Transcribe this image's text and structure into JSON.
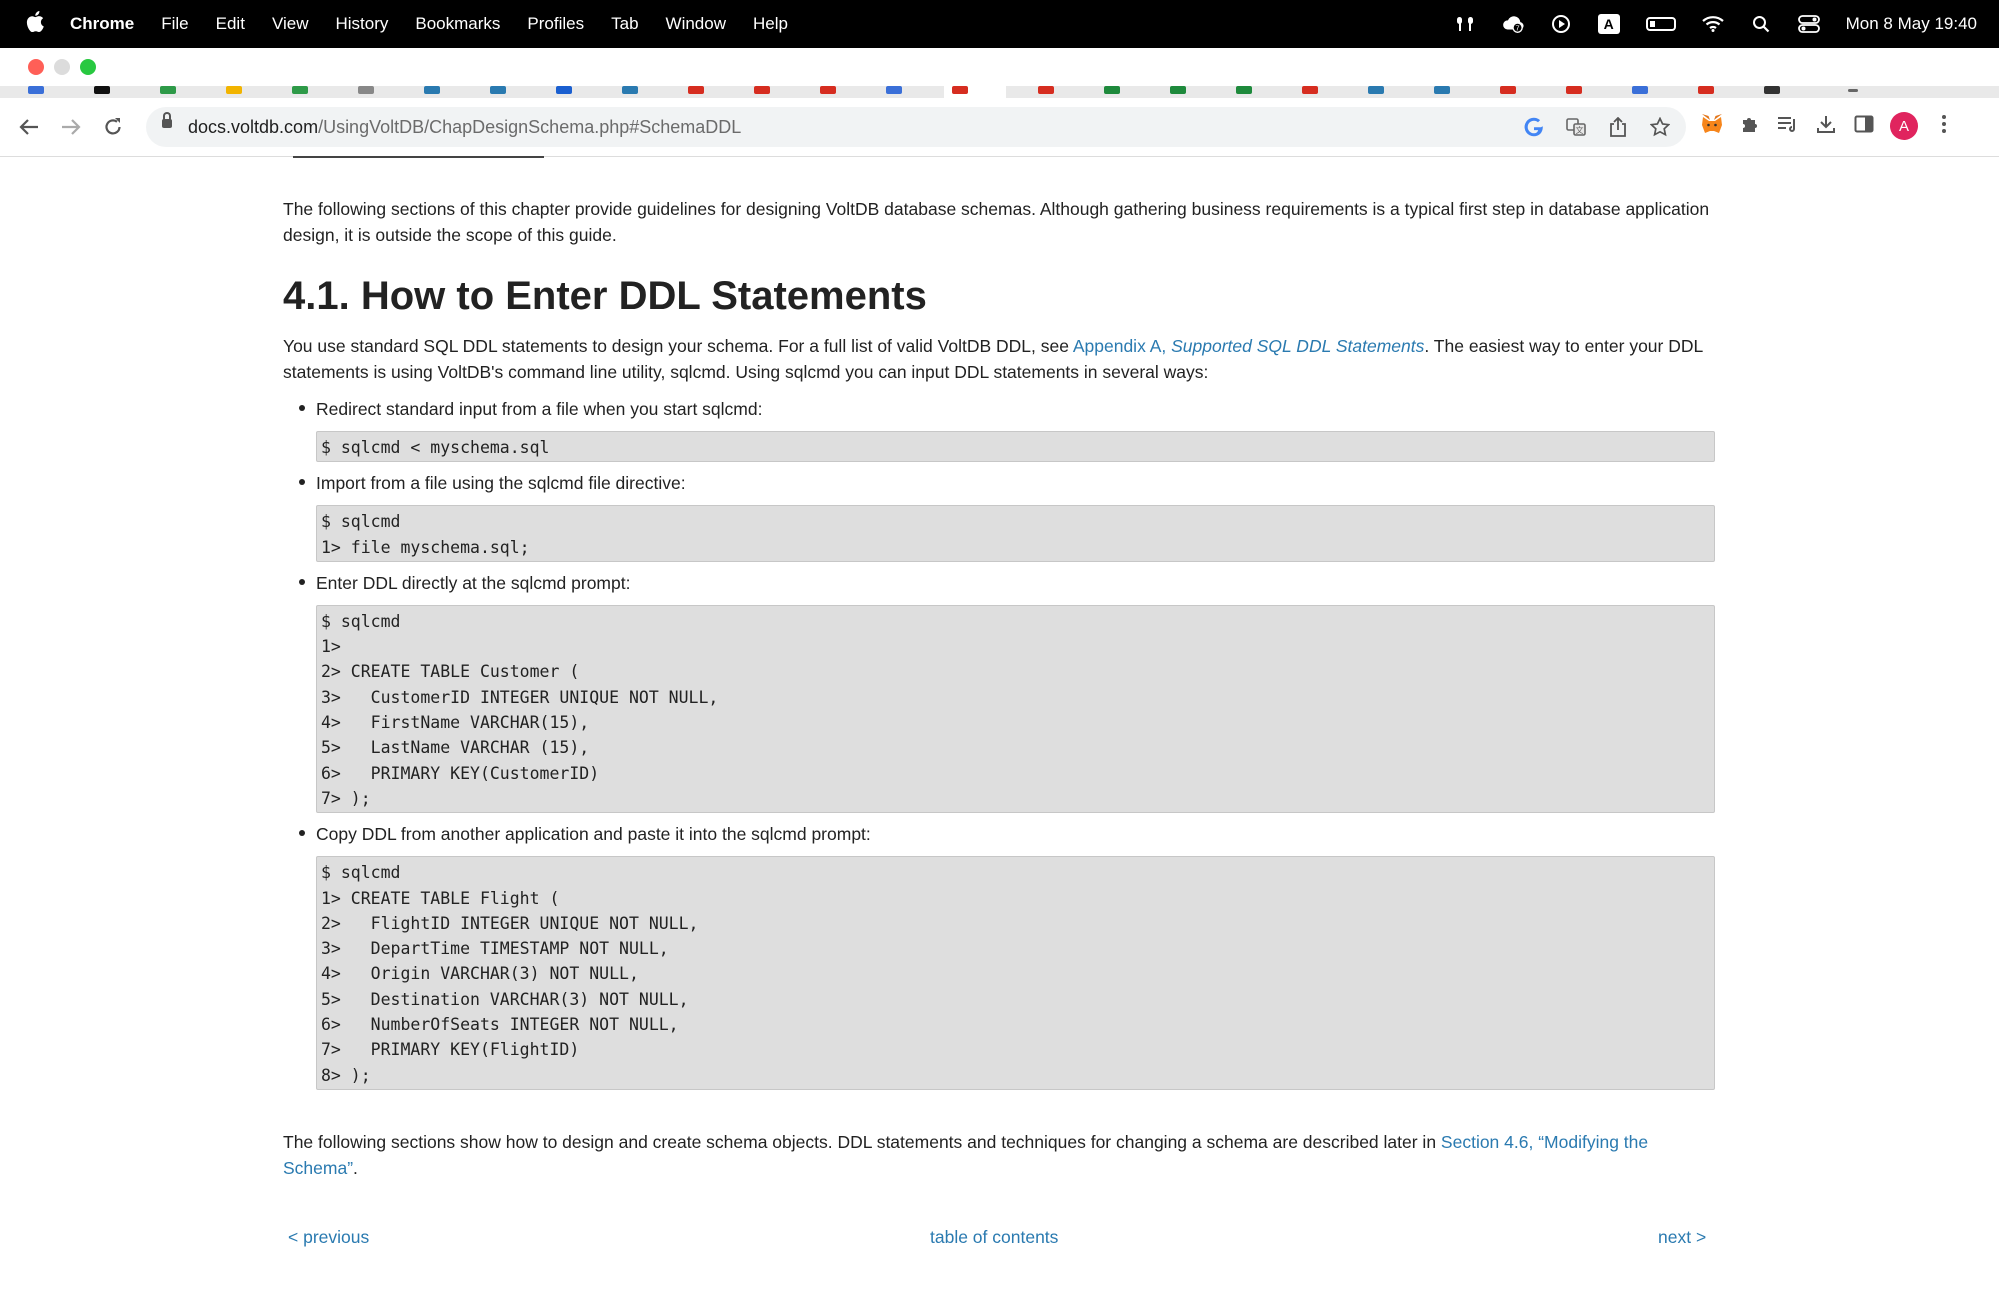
{
  "menubar": {
    "app_name": "Chrome",
    "items": [
      "File",
      "Edit",
      "View",
      "History",
      "Bookmarks",
      "Profiles",
      "Tab",
      "Window",
      "Help"
    ],
    "status_keyboard": "A",
    "clock": "Mon 8 May  19:40"
  },
  "toolbar": {
    "url_host": "docs.voltdb.com",
    "url_path": "/UsingVoltDB/ChapDesignSchema.php#SchemaDDL",
    "profile_initial": "A"
  },
  "page": {
    "intro": "The following sections of this chapter provide guidelines for designing VoltDB database schemas. Although gathering business requirements is a typical first step in database application design, it is outside the scope of this guide.",
    "heading": "4.1. How to Enter DDL Statements",
    "para1_start": "You use standard SQL DDL statements to design your schema. For a full list of valid VoltDB DDL, see ",
    "para1_link_a": "Appendix A, ",
    "para1_link_b": "Supported SQL DDL Statements",
    "para1_end": ". The easiest way to enter your DDL statements is using VoltDB's command line utility, sqlcmd. Using sqlcmd you can input DDL statements in several ways:",
    "ways": [
      {
        "label": "Redirect standard input from a file when you start sqlcmd:",
        "code": "$ sqlcmd < myschema.sql"
      },
      {
        "label": "Import from a file using the sqlcmd file directive:",
        "code": "$ sqlcmd\n1> file myschema.sql;"
      },
      {
        "label": "Enter DDL directly at the sqlcmd prompt:",
        "code": "$ sqlcmd\n1>\n2> CREATE TABLE Customer (\n3>   CustomerID INTEGER UNIQUE NOT NULL,\n4>   FirstName VARCHAR(15),\n5>   LastName VARCHAR (15),\n6>   PRIMARY KEY(CustomerID)\n7> );"
      },
      {
        "label": "Copy DDL from another application and paste it into the sqlcmd prompt:",
        "code": "$ sqlcmd\n1> CREATE TABLE Flight (\n2>   FlightID INTEGER UNIQUE NOT NULL,\n3>   DepartTime TIMESTAMP NOT NULL,\n4>   Origin VARCHAR(3) NOT NULL,\n5>   Destination VARCHAR(3) NOT NULL,\n6>   NumberOfSeats INTEGER NOT NULL,\n7>   PRIMARY KEY(FlightID)\n8> );"
      }
    ],
    "para2_start": "The following sections show how to design and create schema objects. DDL statements and techniques for changing a schema are described later in ",
    "para2_link": "Section 4.6, “Modifying the Schema”",
    "para2_end": "."
  },
  "pager": {
    "previous": "< previous",
    "toc": "table of contents",
    "next": "next >"
  },
  "colors": {
    "link": "#2a7ab0",
    "code_bg": "#dedede",
    "menubar_bg": "#000000"
  }
}
